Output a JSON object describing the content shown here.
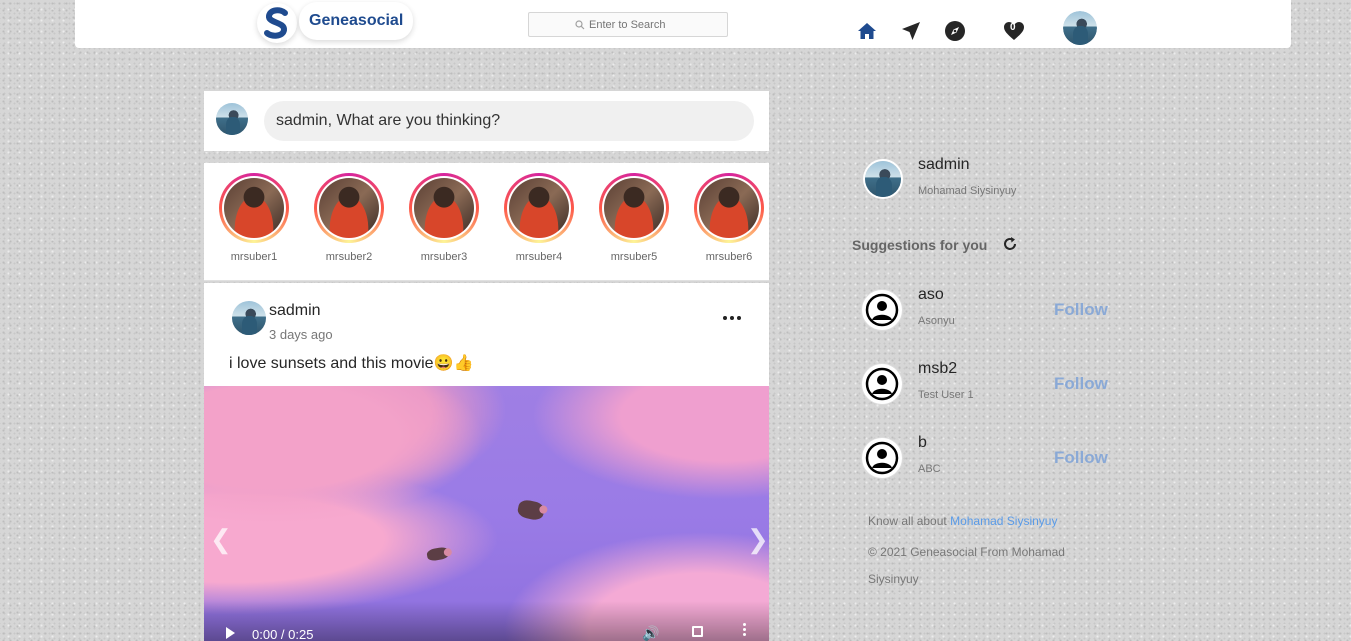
{
  "header": {
    "brand_name": "Geneasocial",
    "search_placeholder": "Enter to Search",
    "notification_count": "0",
    "colors": {
      "brand": "#1f4b8f",
      "nav_active": "#1f4b8f"
    },
    "nav_icons": [
      "home-icon",
      "direct-send-icon",
      "explore-compass-icon",
      "likes-heart-icon"
    ]
  },
  "composer": {
    "placeholder": "sadmin, What are you thinking?"
  },
  "stories": [
    {
      "name": "mrsuber1"
    },
    {
      "name": "mrsuber2"
    },
    {
      "name": "mrsuber3"
    },
    {
      "name": "mrsuber4"
    },
    {
      "name": "mrsuber5"
    },
    {
      "name": "mrsuber6"
    }
  ],
  "post": {
    "author": "sadmin",
    "time": "3 days ago",
    "caption": "i love sunsets and this movie😀👍",
    "video_time": "0:00 / 0:25"
  },
  "sidebar": {
    "current_user": {
      "username": "sadmin",
      "name": "Mohamad Siysinyuy"
    },
    "suggestions_title": "Suggestions for you",
    "suggestions": [
      {
        "username": "aso",
        "name": "Asonyu",
        "action": "Follow"
      },
      {
        "username": "msb2",
        "name": "Test User 1",
        "action": "Follow"
      },
      {
        "username": "b",
        "name": "ABC",
        "action": "Follow"
      }
    ],
    "footer": {
      "know_prefix": "Know all about",
      "know_link": "Mohamad Siysinyuy",
      "copyright": "© 2021 Geneasocial From Mohamad Siysinyuy"
    }
  }
}
